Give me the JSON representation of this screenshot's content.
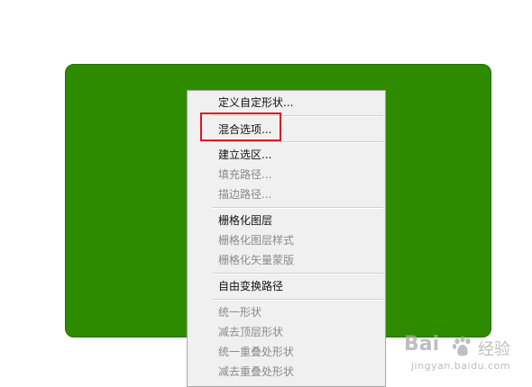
{
  "context_menu": {
    "items": [
      {
        "label": "定义自定形状...",
        "enabled": true
      },
      {
        "label": "混合选项...",
        "enabled": true
      },
      {
        "label": "建立选区...",
        "enabled": true
      },
      {
        "label": "填充路径...",
        "enabled": false
      },
      {
        "label": "描边路径...",
        "enabled": false
      },
      {
        "label": "栅格化图层",
        "enabled": true
      },
      {
        "label": "栅格化图层样式",
        "enabled": false
      },
      {
        "label": "栅格化矢量蒙版",
        "enabled": false
      },
      {
        "label": "自由变换路径",
        "enabled": true
      },
      {
        "label": "统一形状",
        "enabled": false
      },
      {
        "label": "减去顶层形状",
        "enabled": false
      },
      {
        "label": "统一重叠处形状",
        "enabled": false
      },
      {
        "label": "减去重叠处形状",
        "enabled": false
      }
    ]
  },
  "colors": {
    "shape_fill": "#2e8b00",
    "highlight": "#e0131f"
  },
  "watermark": {
    "logo": "Bai",
    "logo_suffix": "经验",
    "url": "jingyan.baidu.com"
  }
}
